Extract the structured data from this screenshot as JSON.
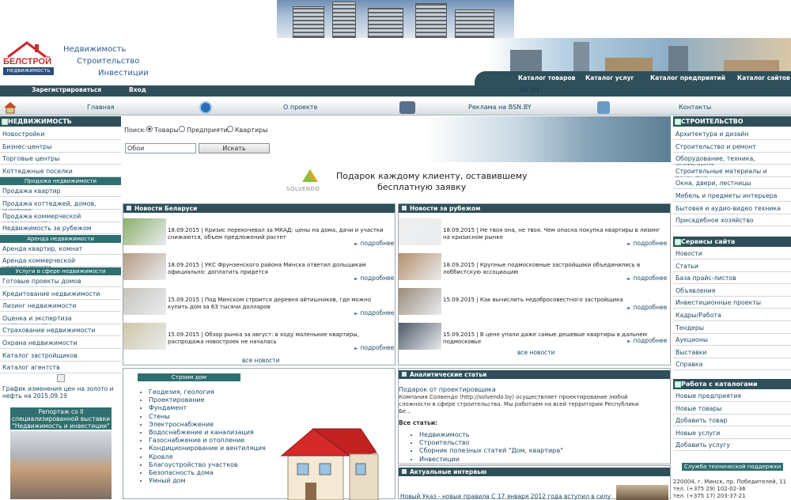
{
  "logo": {
    "line1": "БЕЛСТРОЙ",
    "line2": "недвижимость"
  },
  "slogan": [
    "Недвижимость",
    "Строительство",
    "Инвестиции"
  ],
  "auth": {
    "register": "Зарегистрироваться",
    "login": "Вход"
  },
  "catalogs": [
    "Каталог товаров",
    "Каталог услуг",
    "Каталог предприятий",
    "Каталог сайтов"
  ],
  "marquee": "SN.BY!",
  "menu": [
    "Главная",
    "О проекте",
    "Реклама на BSN.BY",
    "Контакты"
  ],
  "left": {
    "title": "НЕДВИЖИМОСТЬ",
    "group1": [
      "Новостройки",
      "Бизнес-центры",
      "Торговые центры",
      "Коттеджные поселки"
    ],
    "sub1": "Продажа недвижимости",
    "group2": [
      "Продажа квартир",
      "Продажа коттеджей, домов, участков",
      "Продажа коммерческой недвижимости",
      "Недвижимость за рубежом"
    ],
    "sub2": "Аренда недвижимости",
    "group3": [
      "Аренда квартир, комнат",
      "Аренда коммерческой недвижимости"
    ],
    "sub3": "Услуги в сфере недвижимости",
    "group4": [
      "Готовые проекты домов",
      "Кредитование недвижимости",
      "Лизинг недвижимости",
      "Оценка и экспертиза недвижимости",
      "Страхование недвижимости",
      "Охрана недвижимости",
      "Каталог застройщиков",
      "Каталог агентств"
    ],
    "chart_link": "График изменения цен на золото и нефть на 2015.09.19",
    "report": "Репортаж со II специализированной выставки \"Недвижимость и инвестиции\""
  },
  "search": {
    "label": "Поиск:",
    "options": [
      "Товары",
      "Предприятия",
      "Квартиры"
    ],
    "value": "Обои",
    "button": "Искать"
  },
  "promo": {
    "brand": "SOLVENDO",
    "text1": "Подарок каждому клиенту, оставившему",
    "text2": "бесплатную заявку"
  },
  "news_by": {
    "title": "Новости Беларуси",
    "items": [
      "18.09.2015 | Кризис перекочевал за МКАД: цены на дома, дачи и участки снижаются, объем предложений растет",
      "18.09.2015 | УКС Фрунзенского района Минска ответил дольщикам официально: доплатить придется",
      "15.09.2015 | Под Минском строится деревня айтишников, где можно купить дом за 63 тысячи долларов",
      "15.09.2015 | Обзор рынка за август: в ходу маленькие квартиры, распродажа новостроек не началась"
    ],
    "more": "подробнее",
    "all": "все новости"
  },
  "news_abroad": {
    "title": "Новости за рубежом",
    "items": [
      "18.09.2015 | Не твоя она, не твоя. Чем опасна покупка квартиры в лизинг на кризисном рынке",
      "18.09.2015 | Крупные подмосковные застройщики объединились в лоббистскую ассоциацию",
      "15.09.2015 | Как вычислить недобросовестного застройщика",
      "15.09.2015 | В цене упали даже самые дешевые квартиры в дальнем подмосковье"
    ],
    "more": "подробнее",
    "all": "все новости"
  },
  "build": {
    "title": "Строим дом",
    "items": [
      "Геодезия, геология",
      "Проектирование",
      "Фундамент",
      "Стены",
      "Электроснабжение",
      "Водоснабжение и канализация",
      "Газоснабжение и отопление",
      "Кондиционирование и вентиляция",
      "Кровля",
      "Благоустройство участков",
      "Безопасность дома",
      "Умный дом"
    ]
  },
  "analytics": {
    "title": "Аналитические статьи",
    "lead_title": "Подарок от проектировщика",
    "lead_text": "Компания Солвендо (http://solvendo.by) осуществляет проектирование любой сложности в сфере строительства. Мы работаем на всей территории Республики Бе...",
    "all_label": "Все статьи:",
    "links": [
      "Недвижимость",
      "Строительство",
      "Сборник полезных статей \"Дом, квартира\"",
      "Инвестиции"
    ]
  },
  "interview": {
    "title": "Актуальные интервью",
    "text": "Новый Указ - новые правила С 17 января 2012 года вступил в силу Указ Президента"
  },
  "right": {
    "title": "СТРОИТЕЛЬСТВО",
    "group1": [
      "Архитектура и дизайн",
      "Строительство и ремонт",
      "Оборудование, техника, инструмент",
      "Строительные материалы и покрытия",
      "Окна, двери, лестницы",
      "Мебель и предметы интерьера",
      "Бытовая и аудио-видео техника",
      "Присадебное хозяйство"
    ],
    "services_title": "Сервисы сайта",
    "services": [
      "Новости",
      "Статьи",
      "База прайс-листов",
      "Объявления",
      "Инвестиционные проекты",
      "Кадры/Работа",
      "Тендеры",
      "Аукционы",
      "Выставки",
      "Справка"
    ],
    "catalog_title": "Работа с каталогами",
    "catalog": [
      "Новые предприятия",
      "Новые товары",
      "Добавить товар",
      "Новые услуги",
      "Добавить услугу"
    ],
    "support_title": "Служба технической поддержки",
    "support_lines": [
      "220004, г. Минск, пр. Победителей, 11",
      "тел. (+375 29) 102-02-36",
      "тел. (+375 17) 203-37-21"
    ]
  },
  "colors": {
    "dark": "#2f4f5a",
    "link": "#1f4963",
    "teal": "#2f6f6f"
  }
}
